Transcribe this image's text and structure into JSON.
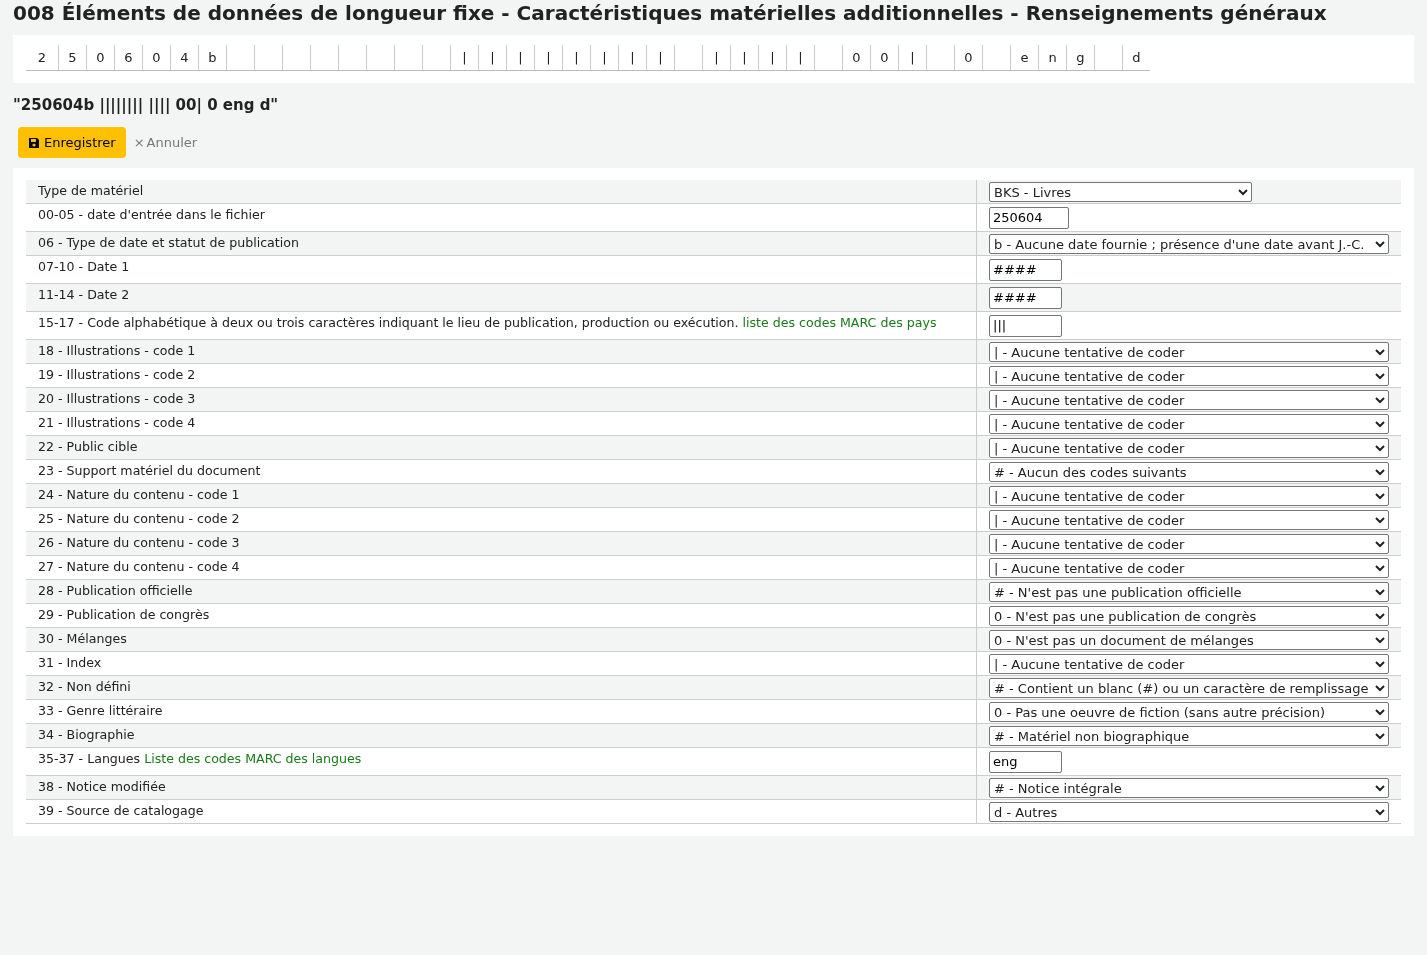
{
  "title": "008 Éléments de données de longueur fixe - Caractéristiques matérielles additionnelles - Renseignements généraux",
  "positions": [
    {
      "kind": "char",
      "char": "2"
    },
    {
      "kind": "char",
      "char": "5"
    },
    {
      "kind": "char",
      "char": "0"
    },
    {
      "kind": "char",
      "char": "6"
    },
    {
      "kind": "char",
      "char": "0"
    },
    {
      "kind": "char",
      "char": "4"
    },
    {
      "kind": "char",
      "char": "b"
    },
    {
      "kind": "blank"
    },
    {
      "kind": "blank"
    },
    {
      "kind": "blank"
    },
    {
      "kind": "blank"
    },
    {
      "kind": "blank"
    },
    {
      "kind": "blank"
    },
    {
      "kind": "blank"
    },
    {
      "kind": "blank"
    },
    {
      "kind": "char",
      "char": "|"
    },
    {
      "kind": "char",
      "char": "|"
    },
    {
      "kind": "char",
      "char": "|"
    },
    {
      "kind": "char",
      "char": "|"
    },
    {
      "kind": "char",
      "char": "|"
    },
    {
      "kind": "char",
      "char": "|"
    },
    {
      "kind": "char",
      "char": "|"
    },
    {
      "kind": "char",
      "char": "|"
    },
    {
      "kind": "blank"
    },
    {
      "kind": "char",
      "char": "|"
    },
    {
      "kind": "char",
      "char": "|"
    },
    {
      "kind": "char",
      "char": "|"
    },
    {
      "kind": "char",
      "char": "|"
    },
    {
      "kind": "blank"
    },
    {
      "kind": "char",
      "char": "0"
    },
    {
      "kind": "char",
      "char": "0"
    },
    {
      "kind": "char",
      "char": "|"
    },
    {
      "kind": "blank"
    },
    {
      "kind": "char",
      "char": "0"
    },
    {
      "kind": "blank"
    },
    {
      "kind": "char",
      "char": "e"
    },
    {
      "kind": "char",
      "char": "n"
    },
    {
      "kind": "char",
      "char": "g"
    },
    {
      "kind": "blank"
    },
    {
      "kind": "char",
      "char": "d"
    }
  ],
  "summary": "\"250604b |||||||| |||| 00| 0 eng d\"",
  "buttons": {
    "save": "Enregistrer",
    "cancel": "Annuler",
    "cancel_icon": "×"
  },
  "rows": [
    {
      "label": "Type de matériel",
      "kind": "select",
      "value": "BKS - Livres"
    },
    {
      "label": "00-05 - date d'entrée dans le fichier",
      "kind": "input",
      "value": "250604"
    },
    {
      "label": "06 - Type de date et statut de publication",
      "kind": "select",
      "value": "b - Aucune date fournie ; présence d'une date avant J.-C."
    },
    {
      "label": "07-10 - Date 1",
      "kind": "input",
      "value": "####"
    },
    {
      "label": "11-14 - Date 2",
      "kind": "input",
      "value": "####"
    },
    {
      "label": "15-17 - Code alphabétique à deux ou trois caractères indiquant le lieu de publication, production ou exécution.",
      "link": "liste des codes MARC des pays",
      "kind": "input",
      "value": "|||"
    },
    {
      "label": "18 - Illustrations - code 1",
      "kind": "select",
      "value": "| - Aucune tentative de coder"
    },
    {
      "label": "19 - Illustrations - code 2",
      "kind": "select",
      "value": "| - Aucune tentative de coder"
    },
    {
      "label": "20 - Illustrations - code 3",
      "kind": "select",
      "value": "| - Aucune tentative de coder"
    },
    {
      "label": "21 - Illustrations - code 4",
      "kind": "select",
      "value": "| - Aucune tentative de coder"
    },
    {
      "label": "22 - Public cible",
      "kind": "select",
      "value": "| - Aucune tentative de coder"
    },
    {
      "label": "23 - Support matériel du document",
      "kind": "select",
      "value": "# - Aucun des codes suivants"
    },
    {
      "label": "24 - Nature du contenu - code 1",
      "kind": "select",
      "value": "| - Aucune tentative de coder"
    },
    {
      "label": "25 - Nature du contenu - code 2",
      "kind": "select",
      "value": "| - Aucune tentative de coder"
    },
    {
      "label": "26 - Nature du contenu - code 3",
      "kind": "select",
      "value": "| - Aucune tentative de coder"
    },
    {
      "label": "27 - Nature du contenu - code 4",
      "kind": "select",
      "value": "| - Aucune tentative de coder"
    },
    {
      "label": "28 - Publication officielle",
      "kind": "select",
      "value": "# - N'est pas une publication officielle"
    },
    {
      "label": "29 - Publication de congrès",
      "kind": "select",
      "value": "0 - N'est pas une publication de congrès"
    },
    {
      "label": "30 - Mélanges",
      "kind": "select",
      "value": "0 - N'est pas un document de mélanges"
    },
    {
      "label": "31 - Index",
      "kind": "select",
      "value": "| - Aucune tentative de coder"
    },
    {
      "label": "32 - Non défini",
      "kind": "select",
      "value": "# - Contient un blanc (#) ou un caractère de remplissage"
    },
    {
      "label": "33 - Genre littéraire",
      "kind": "select",
      "value": "0 - Pas une oeuvre de fiction (sans autre précision)"
    },
    {
      "label": "34 - Biographie",
      "kind": "select",
      "value": "# - Matériel non biographique"
    },
    {
      "label": "35-37 - Langues",
      "link": "Liste des codes MARC des langues",
      "kind": "input",
      "value": "eng"
    },
    {
      "label": "38 - Notice modifiée",
      "kind": "select",
      "value": "# - Notice intégrale"
    },
    {
      "label": "39 - Source de catalogage",
      "kind": "select",
      "value": "d - Autres"
    }
  ]
}
